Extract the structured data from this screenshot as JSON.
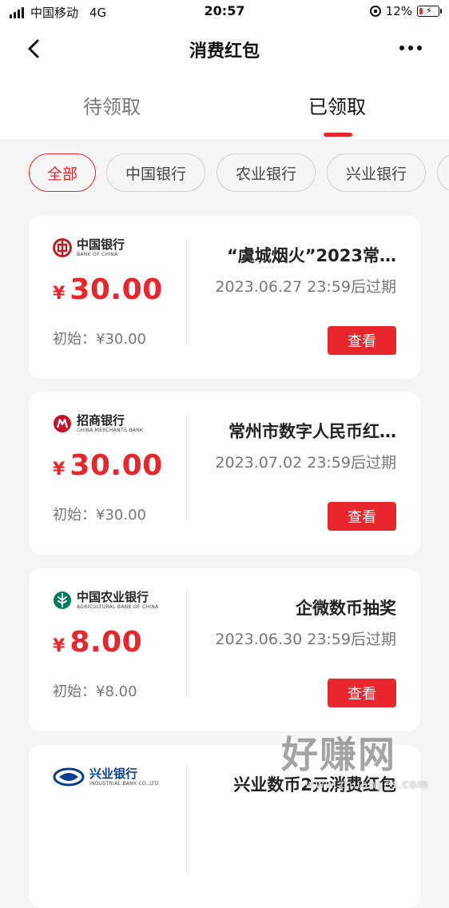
{
  "status_bar": {
    "carrier": "中国移动",
    "network": "4G",
    "time": "20:57",
    "battery": "12%"
  },
  "nav": {
    "title": "消费红包"
  },
  "tabs": [
    {
      "label": "待领取",
      "active": false
    },
    {
      "label": "已领取",
      "active": true
    }
  ],
  "filters": [
    {
      "label": "全部",
      "active": true
    },
    {
      "label": "中国银行",
      "active": false
    },
    {
      "label": "农业银行",
      "active": false
    },
    {
      "label": "兴业银行",
      "active": false
    }
  ],
  "cards": [
    {
      "bank_cn": "中国银行",
      "bank_en": "BANK OF CHINA",
      "currency": "¥",
      "amount": "30.00",
      "initial": "初始：¥30.00",
      "title": "“虞城烟火”2023常…",
      "expire": "2023.06.27 23:59后过期",
      "button": "查看",
      "logo_color": "#b81c22"
    },
    {
      "bank_cn": "招商银行",
      "bank_en": "CHINA MERCHANTS BANK",
      "currency": "¥",
      "amount": "30.00",
      "initial": "初始：¥30.00",
      "title": "常州市数字人民币红…",
      "expire": "2023.07.02 23:59后过期",
      "button": "查看",
      "logo_color": "#c8102e"
    },
    {
      "bank_cn": "中国农业银行",
      "bank_en": "AGRICULTURAL BANK OF CHINA",
      "currency": "¥",
      "amount": "8.00",
      "initial": "初始：¥8.00",
      "title": "企微数币抽奖",
      "expire": "2023.06.30 23:59后过期",
      "button": "查看",
      "logo_color": "#007a5e"
    },
    {
      "bank_cn": "兴业银行",
      "bank_en": "INDUSTRIAL BANK CO.,LTD",
      "currency": "¥",
      "amount": "",
      "initial": "",
      "title": "兴业数币2元消费红包",
      "expire": "",
      "button": "",
      "logo_color": "#0a3d8f"
    }
  ],
  "watermark": {
    "cn": "好赚网",
    "en": "www.zhuanyes.com"
  },
  "colors": {
    "accent": "#e8262d",
    "background": "#f5f5f6"
  }
}
